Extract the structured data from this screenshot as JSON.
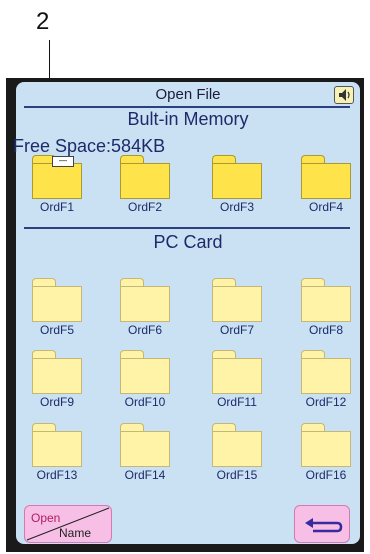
{
  "callout": {
    "number": "2"
  },
  "header": {
    "title": "Open File",
    "speaker_icon": "speaker-icon"
  },
  "builtin": {
    "section_title": "Bult-in Memory",
    "free_space": "Free Space:584KB",
    "folders": [
      "OrdF1",
      "OrdF2",
      "OrdF3",
      "OrdF4"
    ],
    "selected_folder_label": "—"
  },
  "pc_card": {
    "section_title": "PC Card",
    "folders": [
      "OrdF5",
      "OrdF6",
      "OrdF7",
      "OrdF8",
      "OrdF9",
      "OrdF10",
      "OrdF11",
      "OrdF12",
      "OrdF13",
      "OrdF14",
      "OrdF15",
      "OrdF16"
    ]
  },
  "footer": {
    "open_label": "Open",
    "name_label": "Name",
    "back_icon": "return-arrow-icon"
  },
  "colors": {
    "screen_bg": "#c9e1f2",
    "folder_active": "#ffe34a",
    "folder_inactive": "#fff3a8",
    "button_pink": "#f7bfe5",
    "divider": "#2c3f7e"
  }
}
